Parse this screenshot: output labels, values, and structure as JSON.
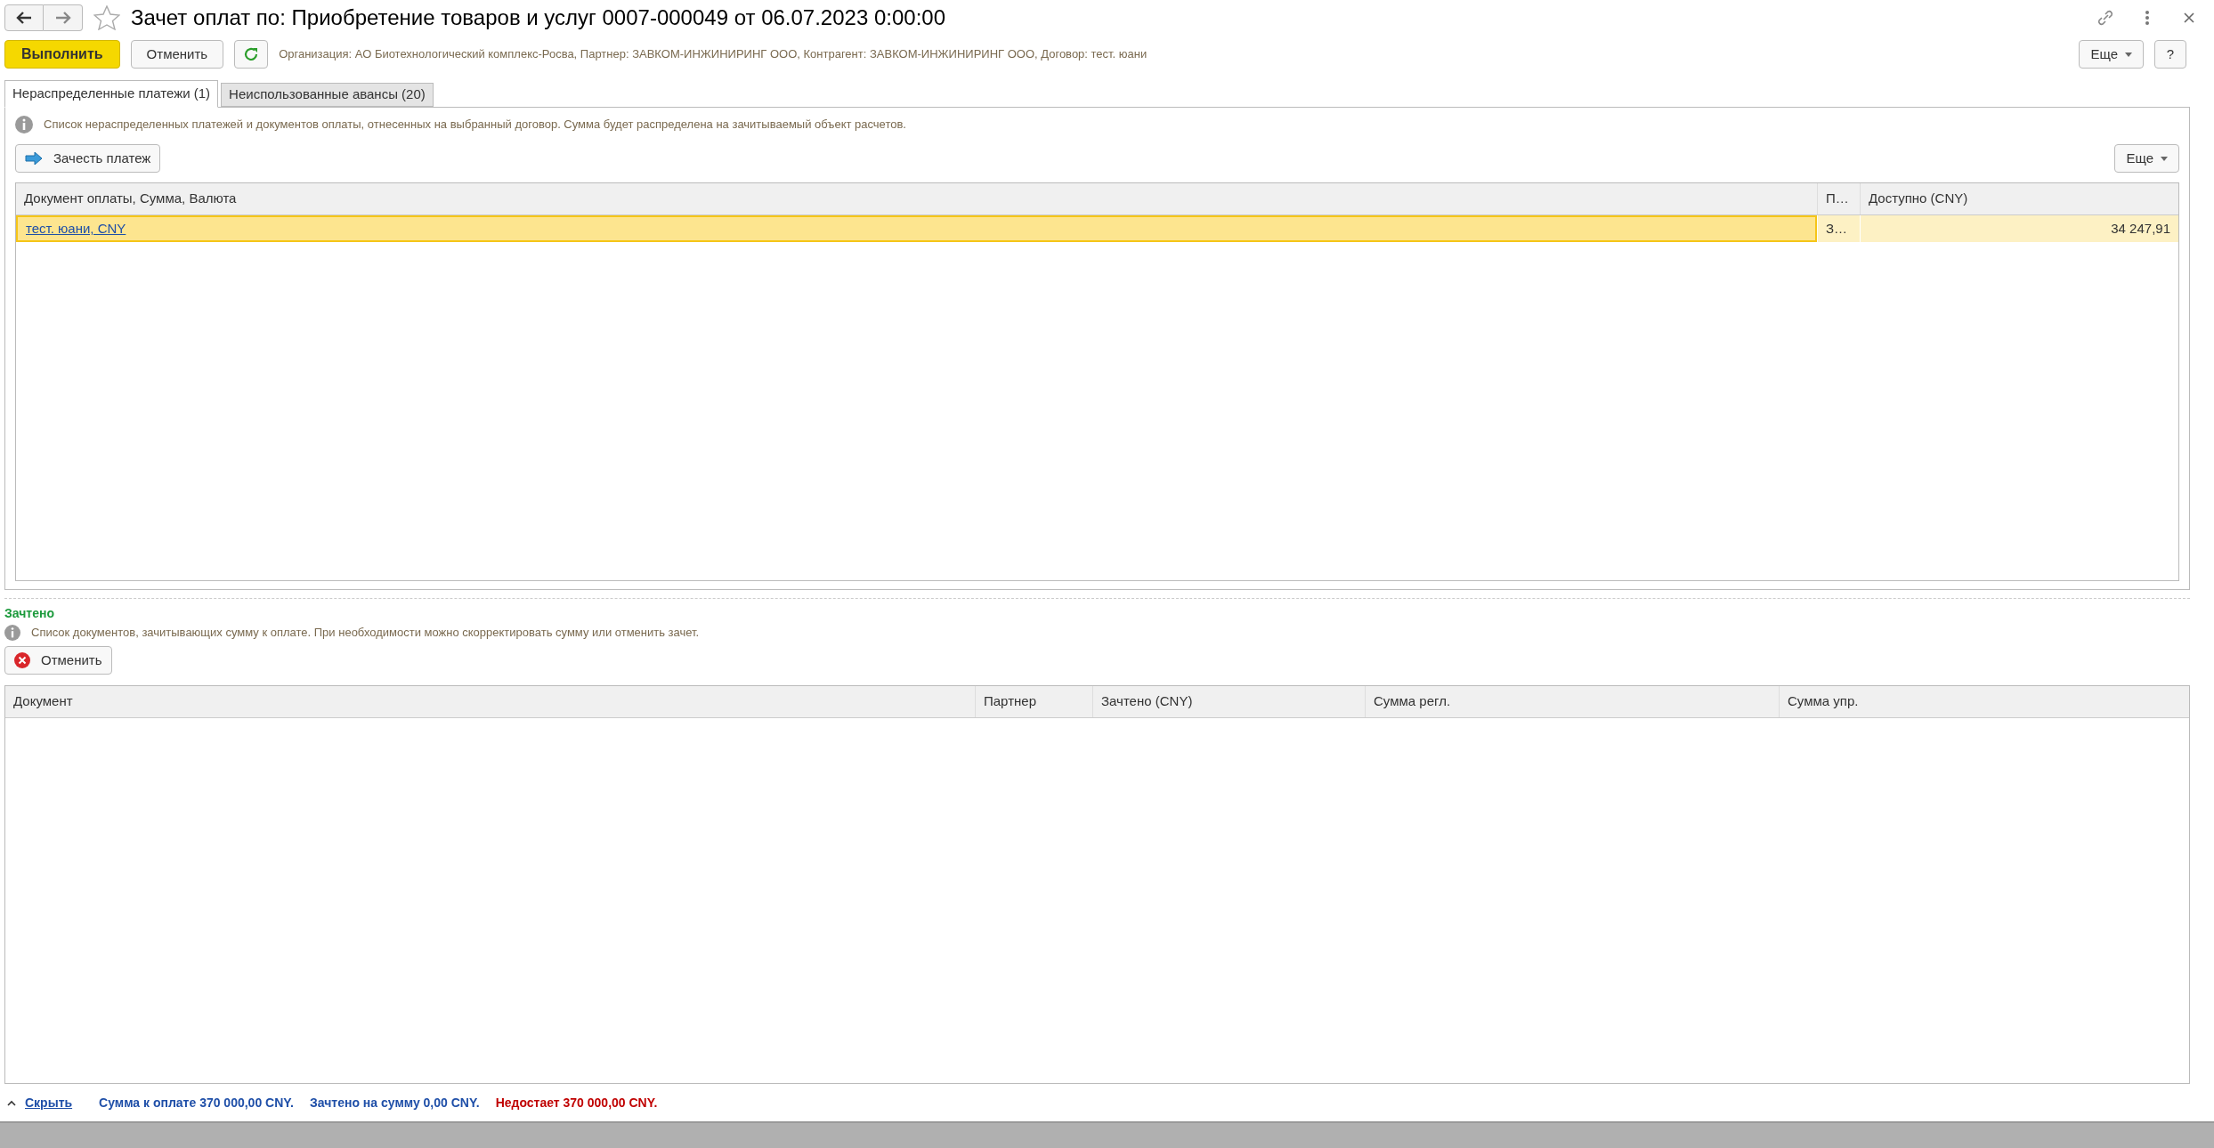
{
  "window": {
    "title": "Зачет оплат по: Приобретение товаров и услуг 0007-000049 от 06.07.2023 0:00:00"
  },
  "toolbar": {
    "execute": "Выполнить",
    "cancel": "Отменить",
    "info": "Организация: АО Биотехнологический комплекс-Росва, Партнер: ЗАВКОМ-ИНЖИНИРИНГ ООО, Контрагент: ЗАВКОМ-ИНЖИНИРИНГ ООО, Договор: тест. юани",
    "more": "Еще",
    "help": "?"
  },
  "tabs": [
    {
      "label": "Нераспределенные платежи (1)",
      "selected": true
    },
    {
      "label": "Неиспользованные авансы (20)",
      "selected": false
    }
  ],
  "payments": {
    "hint": "Список нераспределенных платежей и документов оплаты, отнесенных на выбранный договор. Сумма будет распределена на зачитываемый объект расчетов.",
    "apply": "Зачесть платеж",
    "more": "Еще",
    "columns": [
      "Документ оплаты, Сумма, Валюта",
      "П…",
      "Доступно (CNY)"
    ],
    "rows": [
      {
        "cells": [
          "тест. юани, CNY",
          "З…",
          "34 247,91"
        ],
        "selected": true
      }
    ]
  },
  "offset": {
    "title": "Зачтено",
    "hint": "Список документов, зачитывающих сумму к оплате. При необходимости можно скорректировать сумму или отменить зачет.",
    "cancel": "Отменить",
    "columns": [
      "Документ",
      "Партнер",
      "Зачтено (CNY)",
      "Сумма регл.",
      "Сумма упр."
    ]
  },
  "footer": {
    "hide": "Скрыть",
    "items": [
      {
        "text": "Сумма к оплате 370 000,00 CNY.",
        "color": "#1f4fa8"
      },
      {
        "text": "Зачтено на сумму 0,00 CNY.",
        "color": "#1f4fa8"
      },
      {
        "text": "Недостает 370 000,00 CNY.",
        "color": "#c00000"
      }
    ]
  }
}
